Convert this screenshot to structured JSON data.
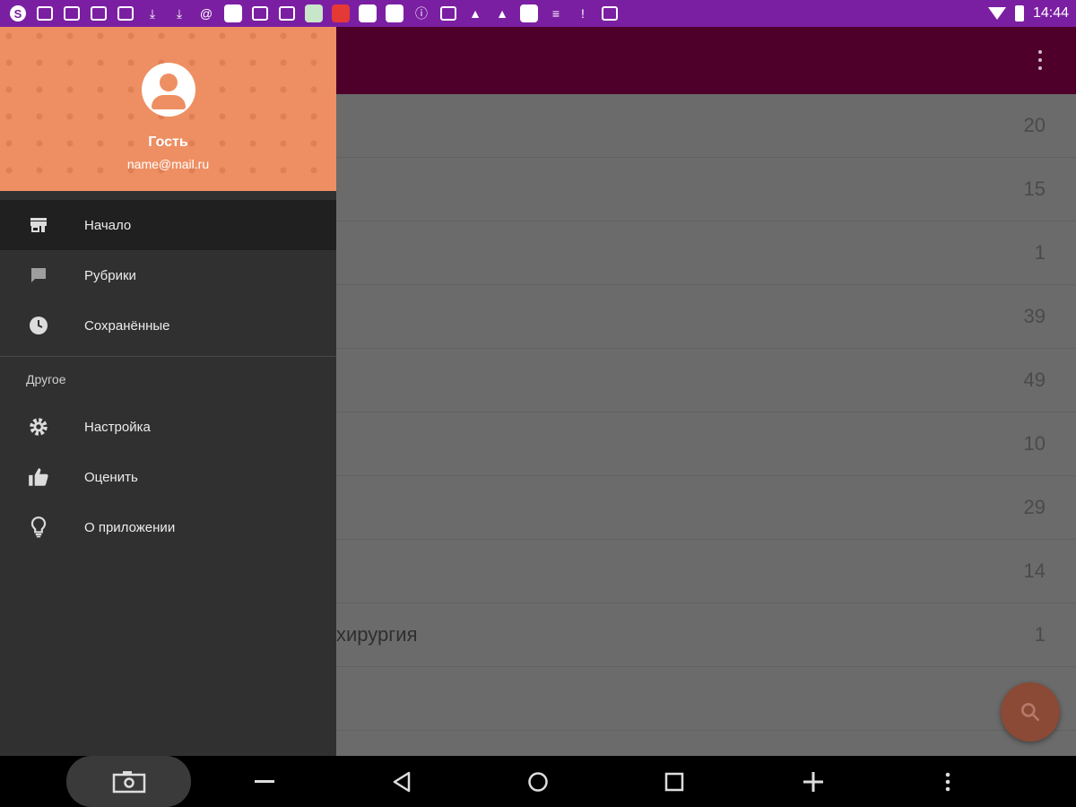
{
  "status_bar": {
    "time": "14:44",
    "colors": {
      "background": "#7b1fa2"
    },
    "notification_icons": [
      "skype-icon",
      "mail-icon",
      "mail-icon",
      "mail-icon",
      "image-icon",
      "download-icon",
      "download-icon",
      "at-icon",
      "app-icon",
      "mail-icon",
      "photo-icon",
      "game-icon",
      "store-icon",
      "app-icon",
      "app-icon",
      "info-icon",
      "note-icon",
      "cleaner-icon",
      "cleaner-icon",
      "app-icon",
      "list-icon",
      "alert-icon",
      "photos-icon"
    ]
  },
  "toolbar": {
    "color": "#4e002a"
  },
  "drawer": {
    "header": {
      "user_name": "Гость",
      "user_email": "name@mail.ru",
      "color": "#ee8f63"
    },
    "primary_items": [
      {
        "label": "Начало",
        "icon": "store-icon",
        "active": true
      },
      {
        "label": "Рубрики",
        "icon": "comment-icon",
        "active": false
      },
      {
        "label": "Сохранённые",
        "icon": "clock-icon",
        "active": false
      }
    ],
    "section_title": "Другое",
    "secondary_items": [
      {
        "label": "Настройка",
        "icon": "gear-icon"
      },
      {
        "label": "Оценить",
        "icon": "thumbs-up-icon"
      },
      {
        "label": "О приложении",
        "icon": "lightbulb-icon"
      }
    ]
  },
  "content": {
    "rows": [
      {
        "title": "",
        "count": "20"
      },
      {
        "title": "",
        "count": "15"
      },
      {
        "title": "",
        "count": "1"
      },
      {
        "title": "",
        "count": "39"
      },
      {
        "title": "",
        "count": "49"
      },
      {
        "title": "",
        "count": "10"
      },
      {
        "title": "",
        "count": "29"
      },
      {
        "title": "",
        "count": "14"
      },
      {
        "title": "хирургия",
        "count": "1"
      },
      {
        "title": "",
        "count": ""
      }
    ]
  },
  "fab": {
    "icon": "search-icon",
    "color": "#8a4a35"
  },
  "nav_bar": {
    "buttons": [
      "screenshot-icon",
      "minus-icon",
      "back-icon",
      "home-icon",
      "recents-icon",
      "plus-icon",
      "more-vert-icon"
    ]
  }
}
